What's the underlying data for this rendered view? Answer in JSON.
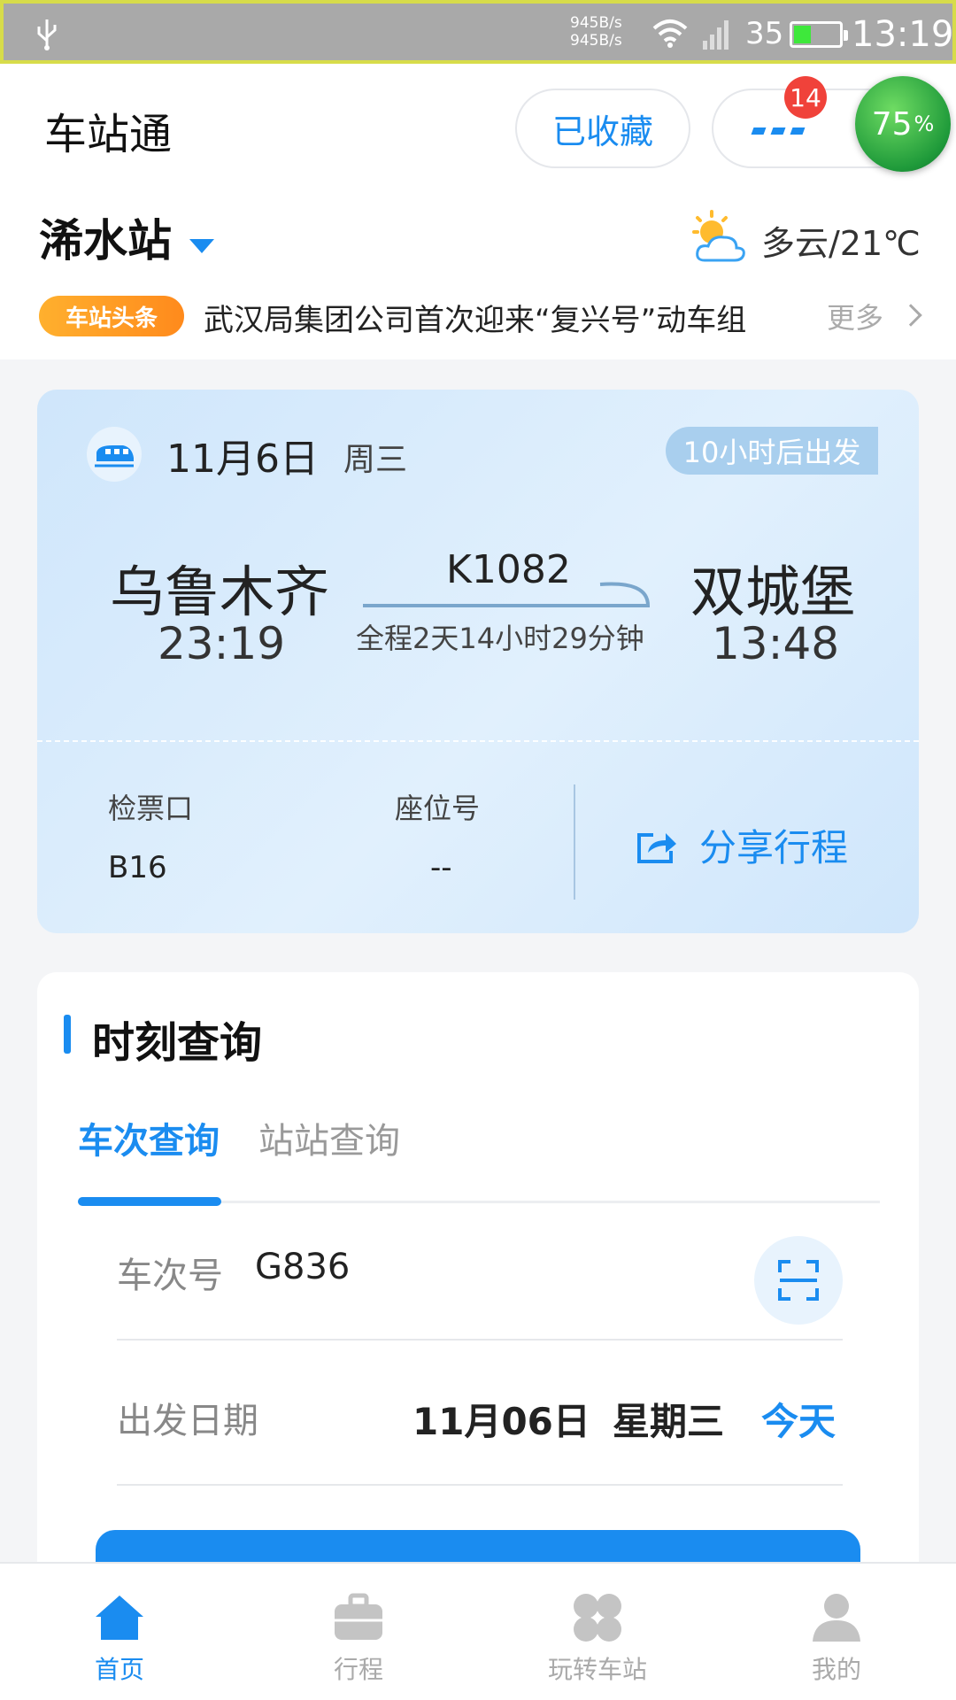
{
  "status_bar": {
    "net_up": "945B/s",
    "net_down": "945B/s",
    "battery_level": "35",
    "battery_fill_fraction": 0.35,
    "time": "13:19"
  },
  "header": {
    "app_title": "车站通",
    "favorites_label": "已收藏",
    "badge_count": "14",
    "progress_value": "75",
    "progress_unit": "%"
  },
  "station": {
    "name": "浠水站",
    "weather": "多云/21℃"
  },
  "news": {
    "tag": "车站头条",
    "headline": "武汉局集团公司首次迎来“复兴号”动车组",
    "more": "更多"
  },
  "trip": {
    "date": "11月6日",
    "weekday": "周三",
    "depart_in": "10小时后出发",
    "from_city": "乌鲁木齐",
    "from_time": "23:19",
    "train_number": "K1082",
    "duration": "全程2天14小时29分钟",
    "to_city": "双城堡",
    "to_time": "13:48",
    "gate_label": "检票口",
    "gate_value": "B16",
    "seat_label": "座位号",
    "seat_value": "--",
    "share_label": "分享行程"
  },
  "query": {
    "title": "时刻查询",
    "tab_train": "车次查询",
    "tab_station": "站站查询",
    "train_label": "车次号",
    "train_value": "G836",
    "date_label": "出发日期",
    "date_value": "11月06日",
    "date_weekday": "星期三",
    "date_today": "今天"
  },
  "bottom_nav": {
    "home": "首页",
    "trips": "行程",
    "explore": "玩转车站",
    "mine": "我的"
  },
  "colors": {
    "accent": "#1a8cf0",
    "news_tag": "#ff9a24",
    "badge": "#f0423a"
  }
}
